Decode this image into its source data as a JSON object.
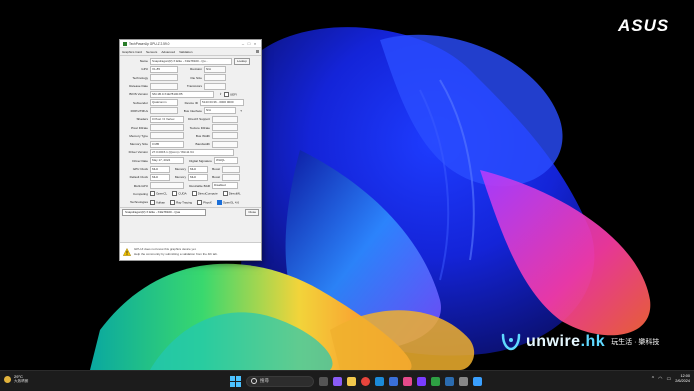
{
  "desktop": {
    "brand_logo": "ASUS",
    "watermark": {
      "brand": "unwire",
      "brand_suffix": ".hk",
      "tagline": "玩生活 · 樂科技"
    }
  },
  "gpuz": {
    "title": "TechPowerUp GPU-Z 2.59.0",
    "tabs": [
      "Graphics Card",
      "Sensors",
      "Advanced",
      "Validation"
    ],
    "rows": {
      "name": {
        "label": "Name",
        "value": "Snapdragon(R) X Elite - X1E78100 - Qu...",
        "button": "Lookup"
      },
      "gpu": {
        "label": "GPU",
        "value": "X1-85",
        "mid": "Revision",
        "value2": "N/A"
      },
      "technology": {
        "label": "Technology",
        "value": "",
        "mid": "Die Size",
        "value2": ""
      },
      "release_date": {
        "label": "Release Date",
        "value": "",
        "mid": "Transistors",
        "value2": ""
      },
      "bios_version": {
        "label": "BIOS Version",
        "value": "SM.1B.0.X1E78100.85",
        "uefi": "UEFI"
      },
      "subvendor": {
        "label": "Subvendor",
        "value": "Qualcomm",
        "mid": "Device ID",
        "value2": "5143 0C36 - 0000 0000"
      },
      "rops_tmus": {
        "label": "ROPs/TMUs",
        "value": "",
        "mid": "Bus Interface",
        "value2": "N/A"
      },
      "shaders": {
        "label": "Shaders",
        "value": "0 Pixel / 0 Vertex",
        "mid": "DirectX Support",
        "value2": ""
      },
      "pixel_fillrate": {
        "label": "Pixel Fillrate",
        "value": "",
        "mid": "Texture Fillrate",
        "value2": ""
      },
      "memory_type": {
        "label": "Memory Type",
        "value": "",
        "mid": "Bus Width",
        "value2": ""
      },
      "memory_size": {
        "label": "Memory Size",
        "value": "0 MB",
        "mid": "Bandwidth",
        "value2": ""
      },
      "driver_version": {
        "label": "Driver Version",
        "value": "27.0.0015.1 (Qcom) / Win11 64"
      },
      "driver_date": {
        "label": "Driver Date",
        "value": "May 17, 2024",
        "mid": "Digital Signature",
        "value2": "WHQL"
      },
      "gpu_clock": {
        "label": "GPU Clock",
        "value": "MHz",
        "mid": "Memory",
        "value2": "MHz",
        "mid2": "Boost",
        "value3": ""
      },
      "default_clock": {
        "label": "Default Clock",
        "value": "MHz",
        "mid": "Memory",
        "value2": "MHz",
        "mid2": "Boost",
        "value3": ""
      },
      "multi_gpu": {
        "label": "Multi-GPU",
        "value": "",
        "mid": "Resizable BAR",
        "value2": "Disabled"
      },
      "computing": {
        "label": "Computing",
        "items": [
          "OpenCL",
          "CUDA",
          "DirectCompute",
          "DirectML"
        ]
      },
      "technologies": {
        "label": "Technologies",
        "items": [
          "Vulkan",
          "Ray Tracing",
          "PhysX",
          "OpenGL 4.6"
        ]
      }
    },
    "footer": {
      "selected_gpu": "Snapdragon(R) X Elite - X1E78100 - Qua",
      "close": "Close"
    },
    "notice": {
      "line1": "GPU-Z does not know this graphics device yet.",
      "line2": "Help the community by submitting a validation from the 4th tab."
    }
  },
  "taskbar": {
    "weather_temp": "29°C",
    "weather_desc": "大致晴朗",
    "search_placeholder": "搜尋",
    "clock_time": "12:00",
    "clock_date": "2/6/2024"
  }
}
